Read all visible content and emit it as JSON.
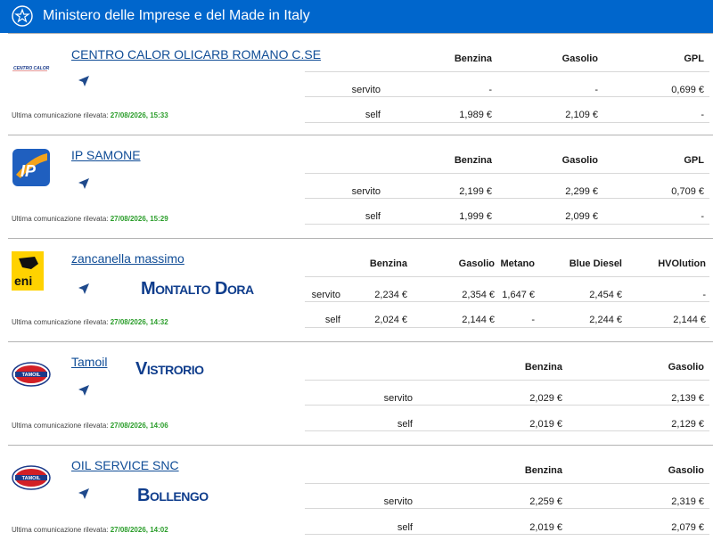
{
  "header": {
    "title": "Ministero delle Imprese e del Made in Italy"
  },
  "common": {
    "last_label": "Ultima comunicazione rilevata:",
    "mode_served": "servito",
    "mode_self": "self"
  },
  "stations": [
    {
      "name": "CENTRO CALOR OLICARB ROMANO C.SE",
      "logo": "centro-calor",
      "logo_text": "CENTRO CALOR",
      "city": "",
      "last": "27/08/2026, 15:33",
      "fuels": [
        "Benzina",
        "Gasolio",
        "GPL"
      ],
      "servito": [
        "-",
        "-",
        "0,699 €"
      ],
      "self": [
        "1,989 €",
        "2,109 €",
        "-"
      ]
    },
    {
      "name": "IP SAMONE",
      "logo": "ip",
      "logo_text": "IP",
      "city": "",
      "last": "27/08/2026, 15:29",
      "fuels": [
        "Benzina",
        "Gasolio",
        "GPL"
      ],
      "servito": [
        "2,199 €",
        "2,299 €",
        "0,709 €"
      ],
      "self": [
        "1,999 €",
        "2,099 €",
        "-"
      ]
    },
    {
      "name": "zancanella massimo",
      "logo": "eni",
      "logo_text": "eni",
      "city": "Montalto Dora",
      "last": "27/08/2026, 14:32",
      "fuels": [
        "Benzina",
        "Gasolio",
        "Metano",
        "Blue Diesel",
        "HVOlution"
      ],
      "servito": [
        "2,234 €",
        "2,354 €",
        "1,647 €",
        "2,454 €",
        "-"
      ],
      "self": [
        "2,024 €",
        "2,144 €",
        "-",
        "2,244 €",
        "2,144 €"
      ]
    },
    {
      "name": "Tamoil",
      "logo": "tamoil",
      "logo_text": "TAMOIL",
      "city": "Vistrorio",
      "last": "27/08/2026, 14:06",
      "fuels": [
        "Benzina",
        "Gasolio"
      ],
      "servito": [
        "2,029 €",
        "2,139 €"
      ],
      "self": [
        "2,019 €",
        "2,129 €"
      ]
    },
    {
      "name": "OIL SERVICE SNC",
      "logo": "tamoil",
      "logo_text": "TAMOIL",
      "city": "Bollengo",
      "last": "27/08/2026, 14:02",
      "fuels": [
        "Benzina",
        "Gasolio"
      ],
      "servito": [
        "2,259 €",
        "2,319 €"
      ],
      "self": [
        "2,019 €",
        "2,079 €"
      ]
    }
  ],
  "colors": {
    "header_bg": "#0066cc",
    "link": "#0f4c96",
    "timestamp": "#2a9d2a",
    "city": "#0f3d8c"
  }
}
